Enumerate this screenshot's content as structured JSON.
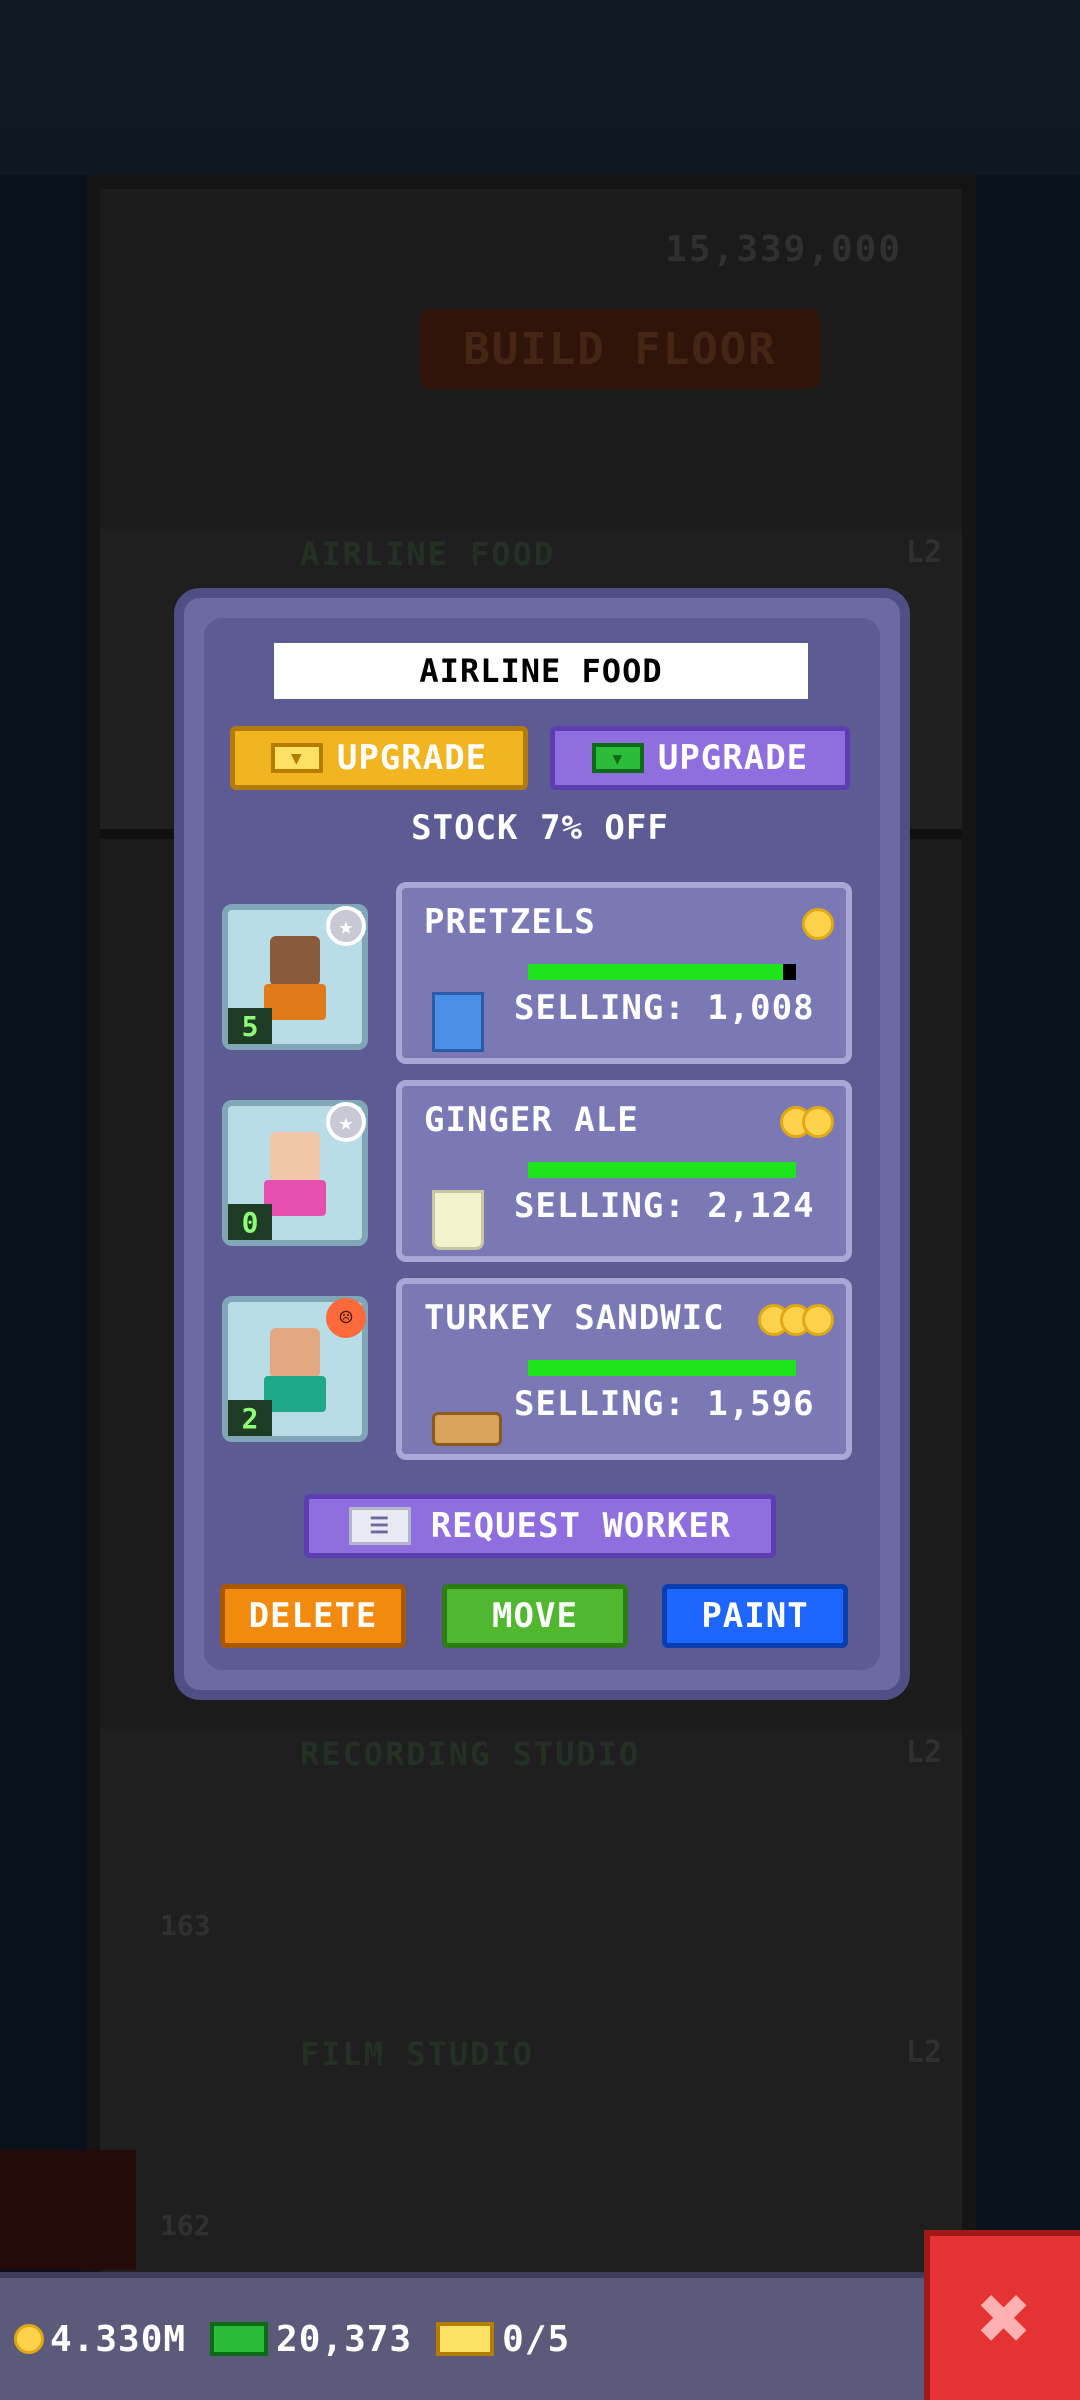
{
  "background": {
    "counter": "15,339,000",
    "build_floor_label": "BUILD FLOOR",
    "floors": [
      {
        "name": "AIRLINE FOOD",
        "level": "L2"
      },
      {
        "name": "RECORDING STUDIO",
        "level": "L2"
      },
      {
        "name": "FILM STUDIO",
        "level": "L2"
      }
    ],
    "floor_numbers": [
      "163",
      "162"
    ]
  },
  "panel": {
    "title": "AIRLINE FOOD",
    "upgrade_gold_label": "UPGRADE",
    "upgrade_cash_label": "UPGRADE",
    "stock_discount": "STOCK 7% OFF",
    "stocks": [
      {
        "name": "PRETZELS",
        "selling": "SELLING: 1,008",
        "coins": 1,
        "fill": 0.95,
        "worker_level": "5",
        "worker_badge": "star",
        "item_icon": "pretzel-bag-icon"
      },
      {
        "name": "GINGER ALE",
        "selling": "SELLING: 2,124",
        "coins": 2,
        "fill": 1.0,
        "worker_level": "0",
        "worker_badge": "star",
        "item_icon": "glass-icon"
      },
      {
        "name": "TURKEY SANDWIC",
        "selling": "SELLING: 1,596",
        "coins": 3,
        "fill": 1.0,
        "worker_level": "2",
        "worker_badge": "angry",
        "item_icon": "sandwich-icon"
      }
    ],
    "request_worker_label": "REQUEST WORKER",
    "delete_label": "DELETE",
    "move_label": "MOVE",
    "paint_label": "PAINT"
  },
  "hud": {
    "coins": "4.330M",
    "cash": "20,373",
    "tickets": "0/5"
  },
  "colors": {
    "panel": "#6b6aa3",
    "gold_button": "#f3b51f",
    "purple_button": "#8f6ee0",
    "delete": "#f28a10",
    "move": "#4fb82e",
    "paint": "#1f66ff",
    "close": "#e53232"
  }
}
